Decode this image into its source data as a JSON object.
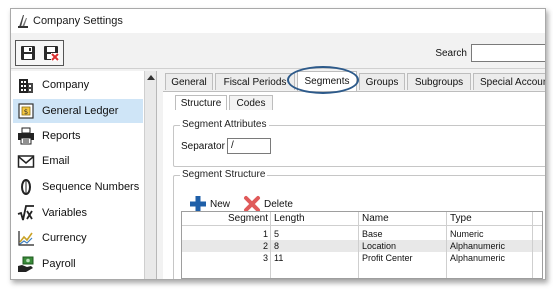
{
  "window": {
    "title": "Company Settings"
  },
  "toolbar": {
    "save_icon": "floppy-disk-icon",
    "delete_icon": "floppy-delete-icon",
    "search_label": "Search",
    "search_value": ""
  },
  "sidebar": {
    "items": [
      {
        "label": "Company",
        "icon": "building-icon"
      },
      {
        "label": "General Ledger",
        "icon": "ledger-icon"
      },
      {
        "label": "Reports",
        "icon": "printer-icon"
      },
      {
        "label": "Email",
        "icon": "envelope-icon"
      },
      {
        "label": "Sequence Numbers",
        "icon": "number-zero-icon"
      },
      {
        "label": "Variables",
        "icon": "sqrt-x-icon"
      },
      {
        "label": "Currency",
        "icon": "chart-icon"
      },
      {
        "label": "Payroll",
        "icon": "hand-money-icon"
      }
    ],
    "selected": "General Ledger"
  },
  "tabs": [
    {
      "label": "General"
    },
    {
      "label": "Fiscal Periods"
    },
    {
      "label": "Segments"
    },
    {
      "label": "Groups"
    },
    {
      "label": "Subgroups"
    },
    {
      "label": "Special Accounts"
    }
  ],
  "active_tab": "Segments",
  "subtabs": [
    {
      "label": "Structure"
    },
    {
      "label": "Codes"
    }
  ],
  "segment_attributes": {
    "title": "Segment Attributes",
    "separator_label": "Separator",
    "separator_value": "/"
  },
  "segment_structure": {
    "title": "Segment Structure",
    "new_label": "New",
    "delete_label": "Delete",
    "columns": [
      "Segment",
      "Length",
      "Name",
      "Type"
    ],
    "rows": [
      {
        "segment": "1",
        "length": "5",
        "name": "Base",
        "type": "Numeric"
      },
      {
        "segment": "2",
        "length": "8",
        "name": "Location",
        "type": "Alphanumeric"
      },
      {
        "segment": "3",
        "length": "11",
        "name": "Profit Center",
        "type": "Alphanumeric"
      }
    ]
  },
  "colors": {
    "selected_bg": "#cfe5f7",
    "highlight_ring": "#2d5a8a",
    "new_icon": "#1f5fa8",
    "delete_icon": "#e05a5a"
  }
}
